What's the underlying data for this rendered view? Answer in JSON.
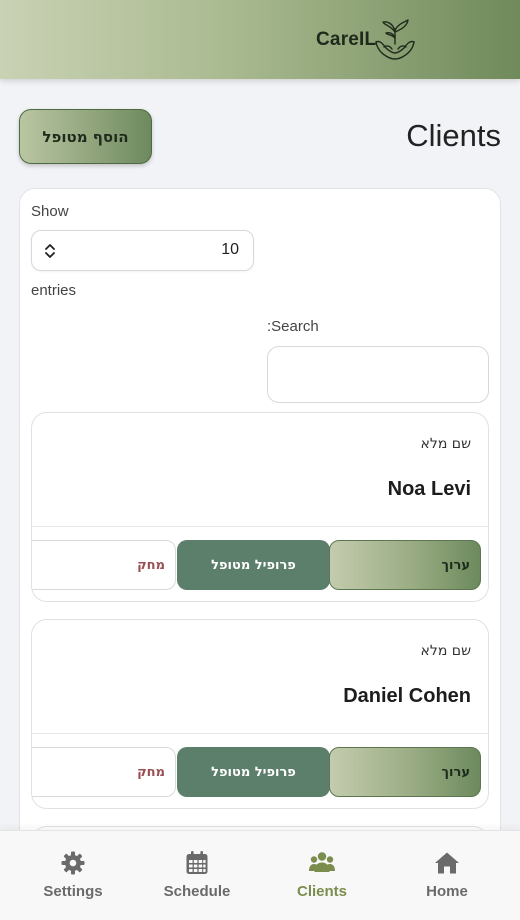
{
  "header": {
    "brand": "CareIL"
  },
  "toolbar": {
    "add_label": "הוסף מטופל",
    "title": "Clients"
  },
  "table": {
    "show_label": "Show",
    "entries_value": "10",
    "entries_label": "entries",
    "search_label": ":Search",
    "search_value": ""
  },
  "clients": [
    {
      "field_label": "שם מלא",
      "name": "Noa Levi",
      "edit": "ערוך",
      "profile": "פרופיל מטופל",
      "delete": "מחק"
    },
    {
      "field_label": "שם מלא",
      "name": "Daniel Cohen",
      "edit": "ערוך",
      "profile": "פרופיל מטופל",
      "delete": "מחק"
    }
  ],
  "nav": {
    "items": [
      {
        "label": "Settings",
        "icon": "gear-icon"
      },
      {
        "label": "Schedule",
        "icon": "calendar-icon"
      },
      {
        "label": "Clients",
        "icon": "users-icon",
        "active": true
      },
      {
        "label": "Home",
        "icon": "home-icon"
      }
    ]
  },
  "colors": {
    "accent": "#7b8d4c",
    "profile_button": "#5c7f6c",
    "delete_text": "#9a4e52"
  }
}
